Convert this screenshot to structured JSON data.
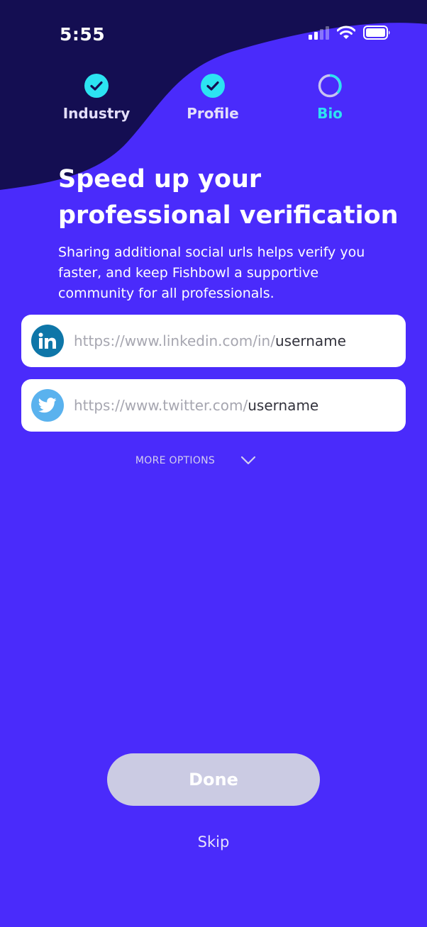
{
  "status_bar": {
    "time": "5:55"
  },
  "colors": {
    "background": "#4a2bfb",
    "header_wave": "#140e52",
    "accent": "#2ce3f2",
    "button_disabled": "#cbcbe3",
    "linkedin": "#0e76a8",
    "twitter": "#5ab2ee"
  },
  "steps": [
    {
      "label": "Industry",
      "state": "complete",
      "icon": "check-circle-icon"
    },
    {
      "label": "Profile",
      "state": "complete",
      "icon": "check-circle-icon"
    },
    {
      "label": "Bio",
      "state": "in-progress",
      "icon": "progress-ring-icon"
    }
  ],
  "heading": {
    "line1": "Speed up your",
    "line2": "professional verification"
  },
  "description": "Sharing additional social urls helps verify you faster, and keep Fishbowl a supportive community for all professionals.",
  "fields": {
    "linkedin": {
      "prefix": "https://www.linkedin.com/in/",
      "placeholder": "username",
      "icon": "linkedin-icon"
    },
    "twitter": {
      "prefix": "https://www.twitter.com/",
      "placeholder": "username",
      "icon": "twitter-icon"
    }
  },
  "more_options": {
    "label": "MORE OPTIONS",
    "icon": "chevron-down-icon"
  },
  "done_label": "Done",
  "skip_label": "Skip"
}
